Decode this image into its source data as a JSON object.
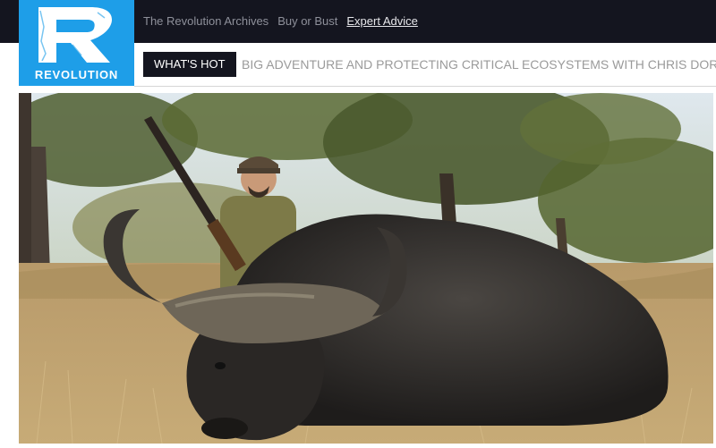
{
  "logo": {
    "letter": "R",
    "text": "REVOLUTION"
  },
  "topnav": [
    {
      "label": "The Revolution Archives",
      "active": false
    },
    {
      "label": "Buy or Bust",
      "active": false
    },
    {
      "label": "Expert Advice",
      "active": true
    }
  ],
  "ticker": {
    "badge": "WHAT'S HOT",
    "headline": "BIG ADVENTURE AND PROTECTING CRITICAL ECOSYSTEMS WITH CHRIS DORSEY"
  },
  "hero": {
    "subject": "hunter kneeling behind cape buffalo in savanna",
    "colors": {
      "sky": "#d9e4ec",
      "grass": "#b9a072",
      "buffalo": "#2a2826",
      "foliage": "#5a6a3a"
    }
  }
}
